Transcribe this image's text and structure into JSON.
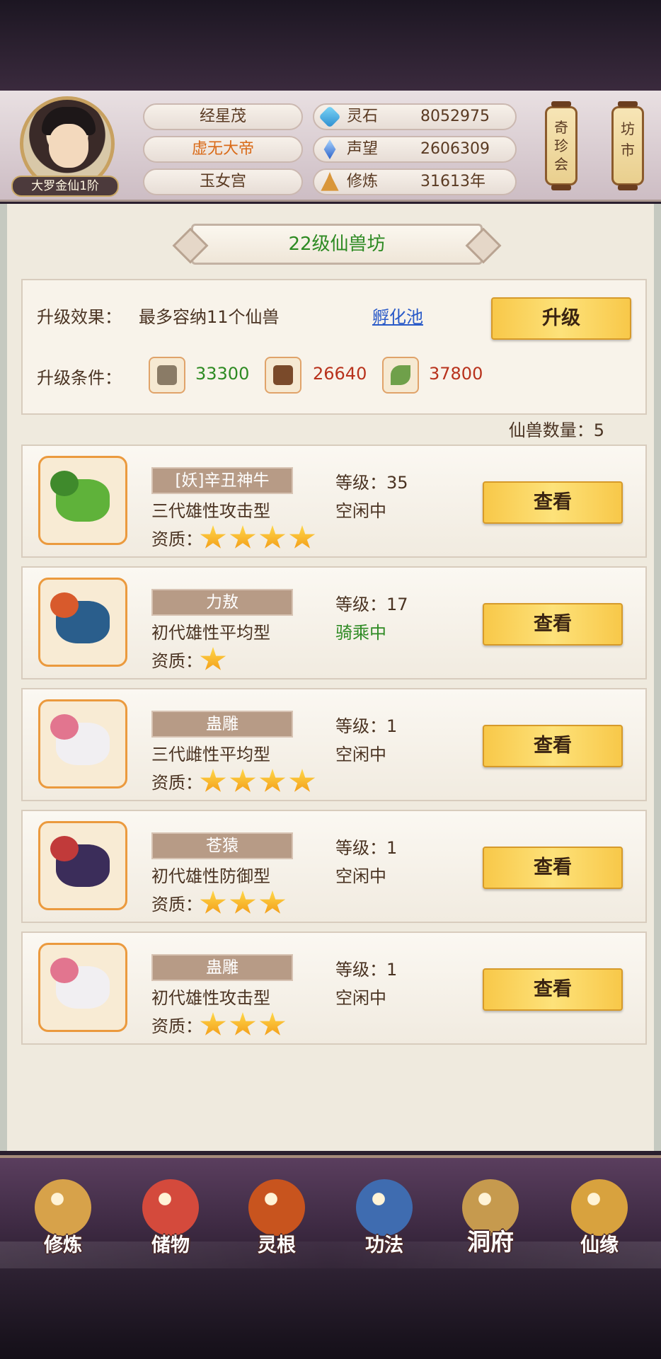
{
  "player": {
    "rank": "大罗金仙1阶",
    "name": "经星茂",
    "title": "虚无大帝",
    "sect": "玉女宫"
  },
  "stats": [
    {
      "label": "灵石",
      "value": "8052975",
      "icon": "spirit-stone-icon"
    },
    {
      "label": "声望",
      "value": "2606309",
      "icon": "reputation-crystal-icon"
    },
    {
      "label": "修炼",
      "value": "31613年",
      "icon": "meditation-icon"
    }
  ],
  "scrolls": {
    "treasure": "奇珍会",
    "market": "坊市"
  },
  "page": {
    "title": "22级仙兽坊"
  },
  "upgrade": {
    "effect_label": "升级效果：",
    "effect_text": "最多容纳11个仙兽",
    "link": "孵化池",
    "button": "升级",
    "cond_label": "升级条件：",
    "materials": [
      {
        "icon": "ore-icon",
        "amount": "33300",
        "color": "#2d8a22"
      },
      {
        "icon": "wood-icon",
        "amount": "26640",
        "color": "#b8321c"
      },
      {
        "icon": "herb-icon",
        "amount": "37800",
        "color": "#b8321c"
      }
    ]
  },
  "beast_count": "仙兽数量：5",
  "beasts": [
    {
      "name": "[妖]辛丑神牛",
      "desc": "三代雄性攻击型",
      "quality_label": "资质：",
      "stars": 4,
      "level": "等级：35",
      "status": "空闲中",
      "status_type": "idle",
      "button": "查看",
      "portrait": "green-ox-icon"
    },
    {
      "name": "力敖",
      "desc": "初代雄性平均型",
      "quality_label": "资质：",
      "stars": 1,
      "level": "等级：17",
      "status": "骑乘中",
      "status_type": "riding",
      "button": "查看",
      "portrait": "qilin-icon"
    },
    {
      "name": "蛊雕",
      "desc": "三代雌性平均型",
      "quality_label": "资质：",
      "stars": 4,
      "level": "等级：1",
      "status": "空闲中",
      "status_type": "idle",
      "button": "查看",
      "portrait": "white-bird-icon"
    },
    {
      "name": "苍猿",
      "desc": "初代雄性防御型",
      "quality_label": "资质：",
      "stars": 3,
      "level": "等级：1",
      "status": "空闲中",
      "status_type": "idle",
      "button": "查看",
      "portrait": "dark-beast-icon"
    },
    {
      "name": "蛊雕",
      "desc": "初代雄性攻击型",
      "quality_label": "资质：",
      "stars": 3,
      "level": "等级：1",
      "status": "空闲中",
      "status_type": "idle",
      "button": "查看",
      "portrait": "white-bird-icon"
    }
  ],
  "nav": [
    {
      "label": "修炼",
      "icon": "cultivate-icon",
      "color": "#d7a24a"
    },
    {
      "label": "储物",
      "icon": "storage-bag-icon",
      "color": "#d44a3c"
    },
    {
      "label": "灵根",
      "icon": "spirit-root-icon",
      "color": "#c8541e"
    },
    {
      "label": "功法",
      "icon": "technique-book-icon",
      "color": "#3f6cb0"
    },
    {
      "label": "洞府",
      "icon": "cave-palace-icon",
      "color": "#c69a4e"
    },
    {
      "label": "仙缘",
      "icon": "gourd-icon",
      "color": "#d8a23e"
    }
  ]
}
